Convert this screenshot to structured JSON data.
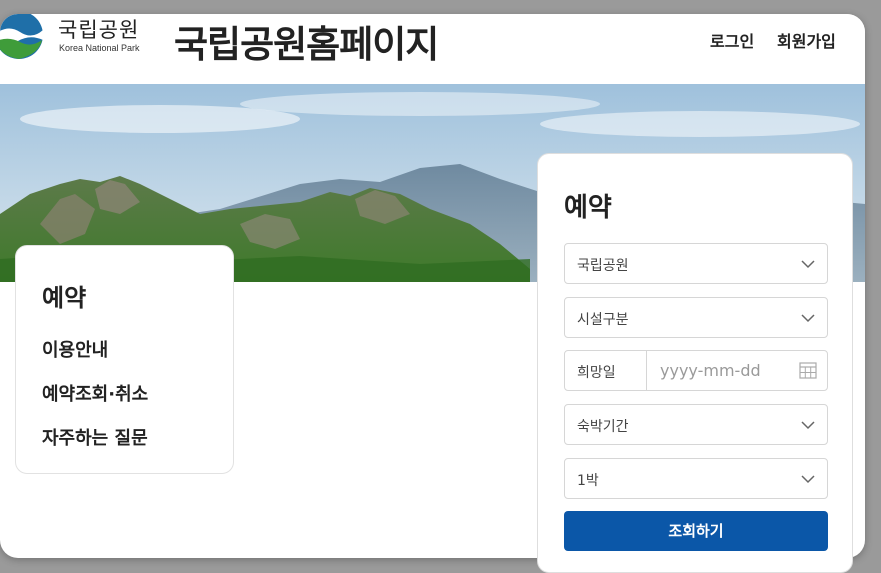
{
  "header": {
    "logo_ko": "국립공원",
    "logo_en": "Korea National Park",
    "title": "국립공원홈페이지",
    "login": "로그인",
    "signup": "회원가입"
  },
  "sidebar": {
    "title": "예약",
    "items": [
      {
        "label": "이용안내"
      },
      {
        "label": "예약조회·취소"
      },
      {
        "label": "자주하는 질문"
      }
    ]
  },
  "reservation": {
    "title": "예약",
    "park_select": {
      "value": "국립공원",
      "icon": "chevron-down-icon"
    },
    "facility_select": {
      "value": "시설구분",
      "icon": "chevron-down-icon"
    },
    "date": {
      "label": "희망일",
      "placeholder": "yyyy-mm-dd",
      "icon": "calendar-icon"
    },
    "stay_select": {
      "value": "숙박기간",
      "icon": "chevron-down-icon"
    },
    "nights_select": {
      "value": "1박",
      "icon": "chevron-down-icon"
    },
    "search_button": "조회하기"
  },
  "colors": {
    "primary_button": "#0b57a8",
    "background_overlay": "#9a9a9a"
  }
}
